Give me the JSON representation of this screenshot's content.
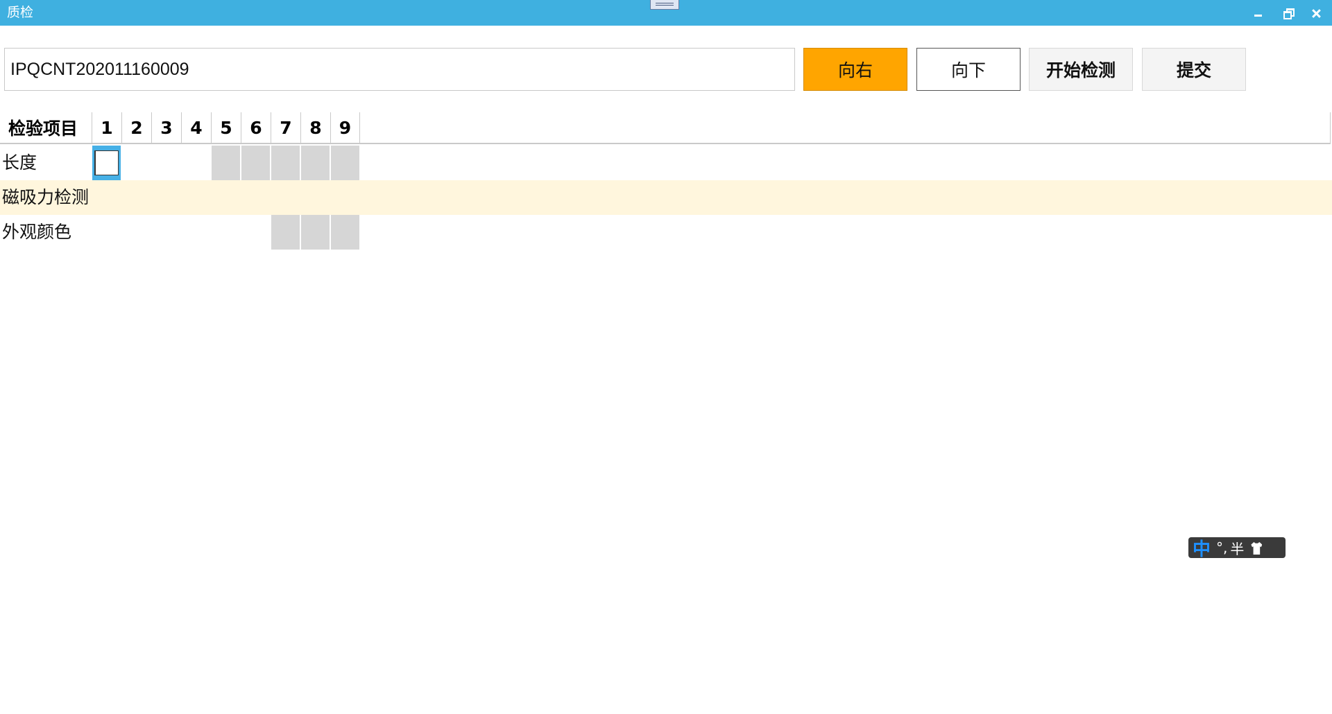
{
  "window": {
    "title": "质检"
  },
  "toolbar": {
    "document_no": "IPQCNT202011160009",
    "right_label": "向右",
    "down_label": "向下",
    "start_label": "开始检测",
    "submit_label": "提交"
  },
  "grid": {
    "header_item": "检验项目",
    "columns": [
      "1",
      "2",
      "3",
      "4",
      "5",
      "6",
      "7",
      "8",
      "9"
    ],
    "rows": [
      {
        "label": "长度",
        "disabled_columns": [
          5,
          6,
          7,
          8,
          9
        ],
        "selected_column": 1
      },
      {
        "label": "磁吸力检测",
        "disabled_columns": []
      },
      {
        "label": "外观颜色",
        "disabled_columns": [
          7,
          8,
          9
        ]
      }
    ]
  },
  "ime": {
    "mode": "中",
    "punct": "°,",
    "width": "半",
    "icon": "shirt-icon"
  },
  "colors": {
    "titlebar": "#3fb0e0",
    "primary_button": "#ffa500",
    "alt_row": "#fff6dd",
    "disabled_cell": "#d6d6d6",
    "selection": "#46b0e6"
  }
}
